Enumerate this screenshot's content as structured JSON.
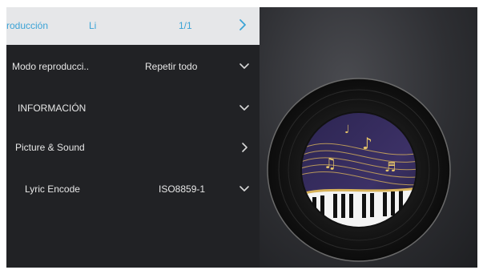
{
  "menu": {
    "top": {
      "label": "roducción",
      "value": "Li",
      "page": "1/1",
      "arrow_icon": "chevron-right-icon"
    },
    "items": [
      {
        "label": "Modo reproducci..",
        "value": "Repetir todo",
        "icon": "chevron-down-icon"
      },
      {
        "label": "INFORMACIÓN",
        "value": "",
        "icon": "chevron-down-icon"
      },
      {
        "label": "Picture & Sound",
        "value": "",
        "icon": "chevron-right-icon"
      },
      {
        "label": "Lyric Encode",
        "value": "ISO8859-1",
        "icon": "chevron-down-icon"
      }
    ]
  },
  "colors": {
    "accent": "#3ba3d6",
    "menu_bg": "#212225",
    "highlight_bg": "#e6e7e9",
    "text": "#e6e6e6"
  },
  "artwork": {
    "icon": "music-disc-artwork"
  }
}
